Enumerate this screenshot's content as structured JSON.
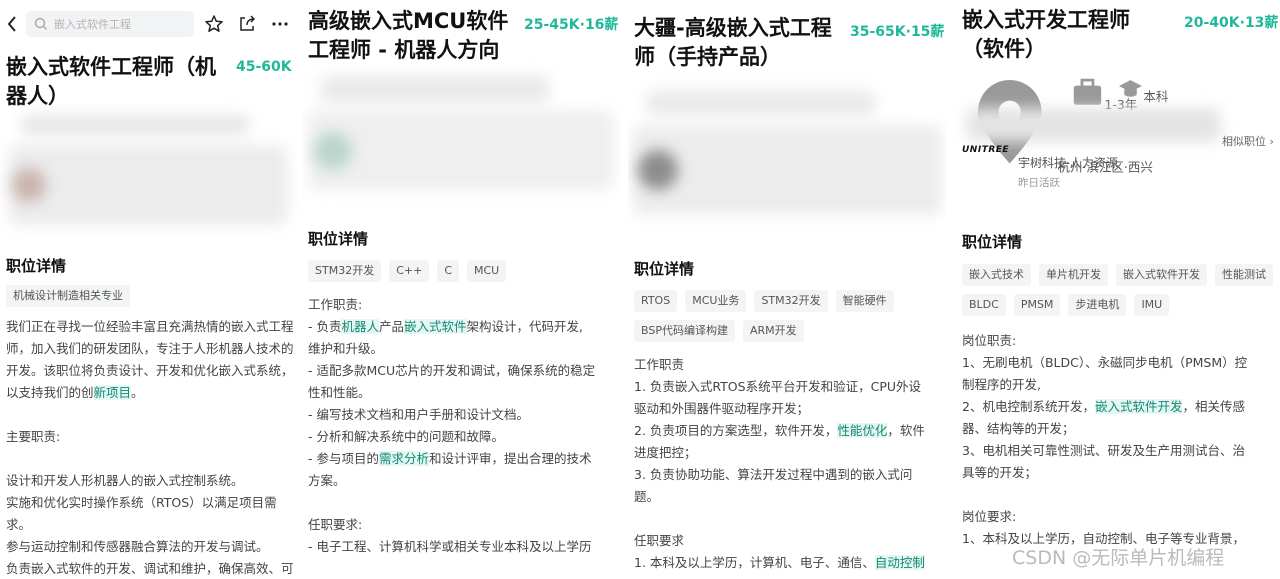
{
  "panel1": {
    "search_placeholder": "嵌入式软件工程",
    "title": "嵌入式软件工程师（机器人）",
    "salary": "45-60K",
    "section_title": "职位详情",
    "tags": [
      "机械设计制造相关专业"
    ],
    "desc": [
      "我们正在寻找一位经验丰富且充满热情的嵌入式工程",
      "师，加入我们的研发团队，专注于人形机器人技术的",
      "开发。该职位将负责设计、开发和优化嵌入式系统，",
      "以支持我们的创新项目。",
      "",
      "主要职责:",
      "",
      "设计和开发人形机器人的嵌入式控制系统。",
      "实施和优化实时操作系统（RTOS）以满足项目需",
      "求。",
      "参与运动控制和传感器融合算法的开发与调试。",
      "负责嵌入式软件的开发、调试和维护，确保高效、可"
    ]
  },
  "panel2": {
    "title": "高级嵌入式MCU软件工程师 - 机器人方向",
    "salary": "25-45K·16薪",
    "section_title": "职位详情",
    "tags": [
      "STM32开发",
      "C++",
      "C",
      "MCU"
    ],
    "desc": [
      "工作职责:",
      "- 负责机器人产品嵌入式软件架构设计，代码开发,",
      "维护和升级。",
      "- 适配多款MCU芯片的开发和调试，确保系统的稳定",
      "性和性能。",
      "- 编写技术文档和用户手册和设计文档。",
      "- 分析和解决系统中的问题和故障。",
      "- 参与项目的需求分析和设计评审，提出合理的技术",
      "方案。",
      "",
      "任职要求:",
      "- 电子工程、计算机科学或相关专业本科及以上学历"
    ]
  },
  "panel3": {
    "title": "大疆-高级嵌入式工程师（手持产品）",
    "salary": "35-65K·15薪",
    "section_title": "职位详情",
    "tags": [
      "RTOS",
      "MCU业务",
      "STM32开发",
      "智能硬件",
      "BSP代码编译构建",
      "ARM开发"
    ],
    "desc": [
      "工作职责",
      "1. 负责嵌入式RTOS系统平台开发和验证，CPU外设",
      "驱动和外围器件驱动程序开发；",
      "2. 负责项目的方案选型，软件开发，性能优化，软件",
      "进度把控；",
      "3. 负责协助功能、算法开发过程中遇到的嵌入式问",
      "题。",
      "",
      "任职要求",
      "1. 本科及以上学历，计算机、电子、通信、自动控制"
    ]
  },
  "panel4": {
    "title": "嵌入式开发工程师（软件）",
    "salary": "20-40K·13薪",
    "location": "杭州·滨江区·西兴",
    "experience": "1-3年",
    "education": "本科",
    "logo_text": "UNITREE",
    "company": "宇树科技·人力资源",
    "active": "昨日活跃",
    "similar": "相似职位",
    "section_title": "职位详情",
    "tags": [
      "嵌入式技术",
      "单片机开发",
      "嵌入式软件开发",
      "性能测试",
      "BLDC",
      "PMSM",
      "步进电机",
      "IMU"
    ],
    "desc": [
      "岗位职责:",
      "1、无刷电机（BLDC）、永磁同步电机（PMSM）控",
      "制程序的开发,",
      "2、机电控制系统开发，嵌入式软件开发，相关传感",
      "器、结构等的开发；",
      "3、电机相关可靠性测试、研发及生产用测试台、治",
      "具等的开发；",
      "",
      "岗位要求:",
      "1、本科及以上学历，自动控制、电子等专业背景，"
    ]
  },
  "watermark": "CSDN @无际单片机编程",
  "colors": {
    "accent": "#1fb89a",
    "highlight_bg": "#e6f6f3",
    "tag_bg": "#f3f4f6"
  }
}
